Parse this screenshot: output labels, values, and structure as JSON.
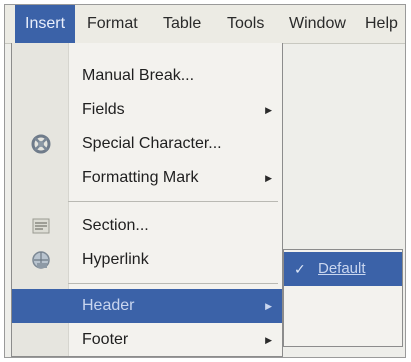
{
  "menubar": {
    "items": [
      "Insert",
      "Format",
      "Table",
      "Tools",
      "Window",
      "Help"
    ],
    "active_index": 0
  },
  "insert_menu": {
    "items": [
      {
        "label": "Manual Break...",
        "icon": "",
        "submenu": false
      },
      {
        "label": "Fields",
        "icon": "",
        "submenu": true
      },
      {
        "label": "Special Character...",
        "icon": "special-character-icon",
        "submenu": false
      },
      {
        "label": "Formatting Mark",
        "icon": "",
        "submenu": true
      },
      {
        "label": "Section...",
        "icon": "section-icon",
        "submenu": false
      },
      {
        "label": "Hyperlink",
        "icon": "hyperlink-icon",
        "submenu": false
      },
      {
        "label": "Header",
        "icon": "",
        "submenu": true,
        "highlighted": true
      },
      {
        "label": "Footer",
        "icon": "",
        "submenu": true
      }
    ]
  },
  "header_submenu": {
    "items": [
      {
        "label": "Default",
        "checked": true,
        "highlighted": true
      }
    ]
  },
  "colors": {
    "highlight": "#3b62a8",
    "menu_background": "#f3f2ee",
    "gutter": "#e6e5df"
  }
}
